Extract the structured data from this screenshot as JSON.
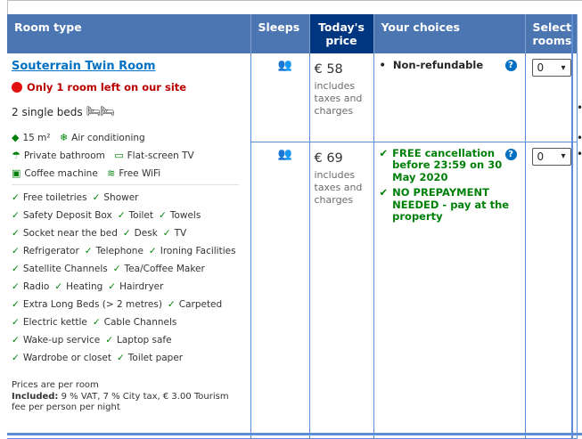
{
  "header": {
    "room_type": "Room type",
    "sleeps": "Sleeps",
    "today_price_1": "Today's",
    "today_price_2": "price",
    "your_choices": "Your choices",
    "select_rooms_1": "Select",
    "select_rooms_2": "rooms"
  },
  "room": {
    "name": "Souterrain Twin Room",
    "scarcity": "Only 1 room left on our site",
    "beds": "2 single beds",
    "facilities": [
      {
        "icon": "size-icon",
        "label": "15 m²"
      },
      {
        "icon": "snowflake-icon",
        "label": "Air conditioning"
      },
      {
        "icon": "shower-icon",
        "label": "Private bathroom"
      },
      {
        "icon": "tv-icon",
        "label": "Flat-screen TV"
      },
      {
        "icon": "coffee-icon",
        "label": "Coffee machine"
      },
      {
        "icon": "wifi-icon",
        "label": "Free WiFi"
      }
    ],
    "amenities": [
      [
        "Free toiletries",
        "Shower"
      ],
      [
        "Safety Deposit Box",
        "Toilet",
        "Towels"
      ],
      [
        "Socket near the bed",
        "Desk",
        "TV"
      ],
      [
        "Refrigerator",
        "Telephone",
        "Ironing Facilities"
      ],
      [
        "Satellite Channels",
        "Tea/Coffee Maker"
      ],
      [
        "Radio",
        "Heating",
        "Hairdryer"
      ],
      [
        "Extra Long Beds (> 2 metres)",
        "Carpeted"
      ],
      [
        "Electric kettle",
        "Cable Channels"
      ],
      [
        "Wake-up service",
        "Laptop safe"
      ],
      [
        "Wardrobe or closet",
        "Toilet paper"
      ]
    ],
    "prices_note": "Prices are per room",
    "included_label": "Included:",
    "included_text": "9 % VAT, 7 % City tax, € 3.00 Tourism fee per person per night"
  },
  "options": [
    {
      "price": "€ 58",
      "includes": [
        "includes",
        "taxes and",
        "charges"
      ],
      "choices": [
        {
          "type": "bullet",
          "text": "Non-refundable"
        }
      ],
      "select_value": "0"
    },
    {
      "price": "€ 69",
      "includes": [
        "includes",
        "taxes and",
        "charges"
      ],
      "choices": [
        {
          "type": "check",
          "text": "FREE cancellation before 23:59 on 30 May 2020"
        },
        {
          "type": "check",
          "text": "NO PREPAYMENT NEEDED - pay at the property"
        }
      ],
      "select_value": "0"
    }
  ],
  "colors": {
    "header": "#4c76b2",
    "header_today": "#003580",
    "link": "#0071c2",
    "green": "#008009",
    "red": "#e21111"
  }
}
